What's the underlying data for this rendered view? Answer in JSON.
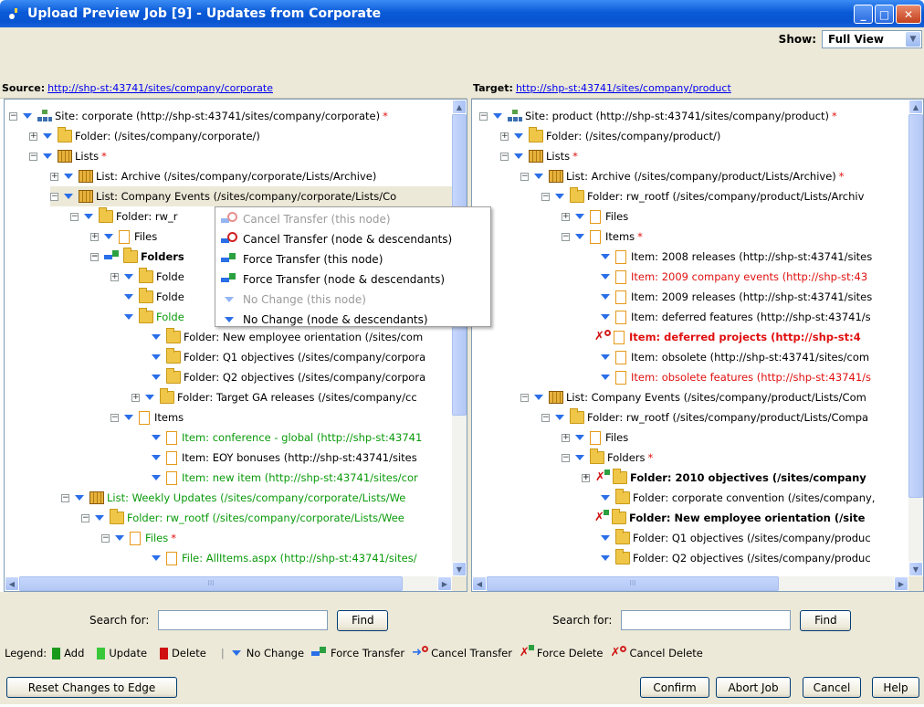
{
  "window": {
    "title": "Upload Preview Job [9] - Updates from Corporate"
  },
  "show": {
    "label": "Show:",
    "value": "Full View"
  },
  "source": {
    "label": "Source:",
    "url": "http://shp-st:43741/sites/company/corporate"
  },
  "target": {
    "label": "Target:",
    "url": "http://shp-st:43741/sites/company/product"
  },
  "source_tree": [
    "Site: corporate (http://shp-st:43741/sites/company/corporate)",
    "Folder:  (/sites/company/corporate/)",
    "Lists",
    "List: Archive (/sites/company/corporate/Lists/Archive)",
    "List: Company Events (/sites/company/corporate/Lists/Co",
    "Folder: rw_r",
    "Files",
    "Folders",
    "Folde",
    "Folde",
    "Folde",
    "Folder: New employee orientation (/sites/com",
    "Folder: Q1 objectives (/sites/company/corpora",
    "Folder: Q2 objectives (/sites/company/corpora",
    "Folder: Target GA releases (/sites/company/cc",
    "Items",
    "Item: conference - global (http://shp-st:43741",
    "Item: EOY bonuses (http://shp-st:43741/sites",
    "Item: new item (http://shp-st:43741/sites/cor",
    "List: Weekly Updates (/sites/company/corporate/Lists/We",
    "Folder: rw_rootf (/sites/company/corporate/Lists/Wee",
    "Files",
    "File: AllItems.aspx (http://shp-st:43741/sites/"
  ],
  "target_tree": [
    "Site: product (http://shp-st:43741/sites/company/product)",
    "Folder:  (/sites/company/product/)",
    "Lists",
    "List: Archive (/sites/company/product/Lists/Archive)",
    "Folder: rw_rootf (/sites/company/product/Lists/Archiv",
    "Files",
    "Items",
    "Item: 2008 releases (http://shp-st:43741/sites",
    "Item: 2009 company events (http://shp-st:43",
    "Item: 2009 releases (http://shp-st:43741/sites",
    "Item: deferred features (http://shp-st:43741/s",
    "Item: deferred projects (http://shp-st:4",
    "Item: obsolete (http://shp-st:43741/sites/com",
    "Item: obsolete features (http://shp-st:43741/s",
    "List: Company Events (/sites/company/product/Lists/Com",
    "Folder: rw_rootf (/sites/company/product/Lists/Compa",
    "Files",
    "Folders",
    "Folder: 2010 objectives (/sites/company",
    "Folder: corporate convention (/sites/company,",
    "Folder: New employee orientation (/site",
    "Folder: Q1 objectives (/sites/company/produc",
    "Folder: Q2 objectives (/sites/company/produc"
  ],
  "context_menu": [
    {
      "label": "Cancel Transfer (this node)",
      "enabled": false
    },
    {
      "label": "Cancel Transfer (node & descendants)",
      "enabled": true
    },
    {
      "label": "Force Transfer (this node)",
      "enabled": true
    },
    {
      "label": "Force Transfer (node & descendants)",
      "enabled": true
    },
    {
      "label": "No Change (this node)",
      "enabled": false
    },
    {
      "label": "No Change (node & descendants)",
      "enabled": true
    }
  ],
  "search": {
    "label": "Search for:",
    "find": "Find"
  },
  "legend": {
    "title": "Legend:",
    "add": "Add",
    "update": "Update",
    "delete": "Delete",
    "nochange": "No Change",
    "force": "Force Transfer",
    "cancel": "Cancel Transfer",
    "forcedelete": "Force Delete",
    "canceldelete": "Cancel Delete",
    "colors": {
      "add": "#1a9a1a",
      "update": "#3ac83a",
      "delete": "#d01010"
    }
  },
  "buttons": {
    "reset": "Reset Changes to Edge",
    "confirm": "Confirm",
    "abort": "Abort Job",
    "cancel": "Cancel",
    "help": "Help"
  },
  "star": "*",
  "scroll_glyph": "III"
}
